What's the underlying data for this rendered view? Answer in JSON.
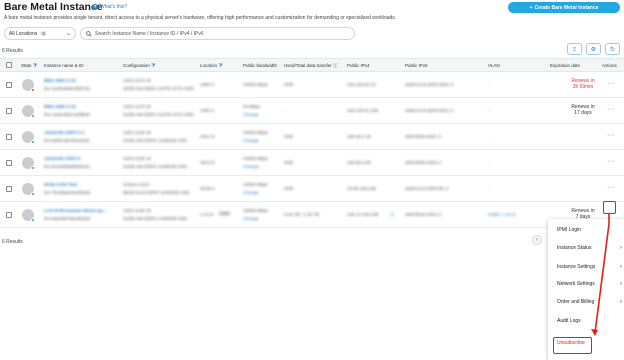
{
  "header": {
    "title": "Bare Metal Instance",
    "whats_this": "What's this?",
    "create_button": "Create Bare Metal Instance",
    "subtitle": "A bare metal instance provides single tenant, direct access to a physical server's hardware, offering high performance and customization for demanding or specialized workloads."
  },
  "filters": {
    "location_label": "All Locations",
    "location_count": "6",
    "search_placeholder": "Search Instance Name / Instance ID / IPv4 / IPv6"
  },
  "results_label": "6 Results",
  "toolbar_icons": [
    "export-icon",
    "settings-icon",
    "refresh-icon"
  ],
  "columns": {
    "state": "State",
    "name": "Instance name & ID",
    "configuration": "Configuration",
    "location": "Location",
    "bandwidth": "Public bandwidth",
    "transfer": "Used/Total data transfer",
    "ipv4": "Public IPv4",
    "ipv6": "Public IPv6",
    "vlan": "VLAN",
    "expiration": "Expiration date",
    "actions": "Actions"
  },
  "rows": [
    {
      "name": "BM1-AMS-C-01",
      "id": "bm-11d4c8a9e0f3b72a",
      "cfg1": "1xE3-1270 v6",
      "cfg2": "32GB 4x8 DDR4 2x2TB SATA HDD",
      "location": "AMS-C",
      "bandwidth": "10000 Mbps",
      "bw_link": "",
      "transfer": "0GB",
      "ipv4": "192.118.52.15",
      "ipv6": "2a09:21c0:a003:3402::2",
      "vlan": "-",
      "exp1": "Renews in",
      "exp2": "3h 59min",
      "exp_red": true,
      "status_color": "#e4382c"
    },
    {
      "name": "BM1-AMS-C-01",
      "id": "bm-11d4c3b2c1a0f9e8",
      "cfg1": "1xE3-1270 v6",
      "cfg2": "32GB 4x8 DDR4 2x2TB SATA HDD",
      "location": "AMS-C",
      "bandwidth": "50 Mbps",
      "bw_link": "Change",
      "transfer": "-",
      "ipv4": "192.118.51.238",
      "ipv6": "2a09:21c0:a003:3401::2",
      "vlan": "-",
      "exp1": "Renews in",
      "exp2": "17 days",
      "exp_red": false,
      "status_color": "#2fb36b"
    },
    {
      "name": "JAGUAR-CERT-1-1",
      "id": "bm-9d3f1c8a7b6e5d4c",
      "cfg1": "1xE3-1230 v6",
      "cfg2": "32GB 4x8 DDR4 1x480GB SSD",
      "location": "HKG-D",
      "bandwidth": "10000 Mbps",
      "bw_link": "Change",
      "transfer": "0GB",
      "ipv4": "156.59.2.46",
      "ipv6": "2602:fb49:1002::2",
      "vlan": "-",
      "exp1": "",
      "exp2": "",
      "exp_red": false,
      "status_color": "#2fb36b"
    },
    {
      "name": "JAGUAR-CERT-2",
      "id": "bm-8c2e0b9a6f5d4e3c",
      "cfg1": "1xE3-1230 v6",
      "cfg2": "32GB 4x8 DDR4 1x480GB SSD",
      "location": "HKG-D",
      "bandwidth": "10000 Mbps",
      "bw_link": "Change",
      "transfer": "0GB",
      "ipv4": "156.59.2.50",
      "ipv6": "2602:fb49:1003::2",
      "vlan": "-",
      "exp1": "",
      "exp2": "",
      "exp_red": false,
      "status_color": "#2fb36b"
    },
    {
      "name": "NCM-A-EU-Test",
      "id": "bm-7b1d9a8c5e4f3a2b",
      "cfg1": "2xXeon 4210",
      "cfg2": "96GB 6x16 DDR4 2x960GB SSD",
      "location": "NCM-A",
      "bandwidth": "10000 Mbps",
      "bw_link": "Change",
      "transfer": "0GB",
      "ipv4": "23.80.128.138",
      "ipv6": "2a09:21c0:2003:05::2",
      "vlan": "-",
      "exp1": "",
      "exp2": "",
      "exp_red": false,
      "status_color": "#2fb36b"
    },
    {
      "name": "LAX-D-EU-master-direct-up...",
      "id": "bm-6a0c8b7d4e3f2a1b",
      "cfg1": "1xE3-1230 v6",
      "cfg2": "32GB 4x8 DDR4 1x480GB SSD",
      "location": "LAX-D",
      "location_tag": "CN2",
      "bandwidth": "10000 Mbps",
      "bw_link": "Change",
      "transfer": "0.00 TB / 1.00 TB",
      "ipv4": "128.14.159.108",
      "ipv4_extra": "+2",
      "ipv6": "2602:fb48:1004::2",
      "vlan": "Public: LAX-D",
      "exp1": "Renews in",
      "exp2": "7 days",
      "exp_red": false,
      "status_color": "#2fb36b"
    }
  ],
  "context_menu": {
    "items": [
      {
        "label": "IPMI Login",
        "submenu": false
      },
      {
        "label": "Instance Status",
        "submenu": true
      },
      {
        "label": "Instance Settings",
        "submenu": true
      },
      {
        "label": "Network Settings",
        "submenu": true
      },
      {
        "label": "Order and Billing",
        "submenu": true
      },
      {
        "label": "Audit Logs",
        "submenu": false
      },
      {
        "label": "Unsubscribe",
        "submenu": false
      }
    ]
  },
  "colors": {
    "accent": "#22a7e0",
    "link": "#2b7fc7",
    "danger": "#e0201a",
    "expiring": "#e4382c",
    "running": "#2fb36b"
  }
}
